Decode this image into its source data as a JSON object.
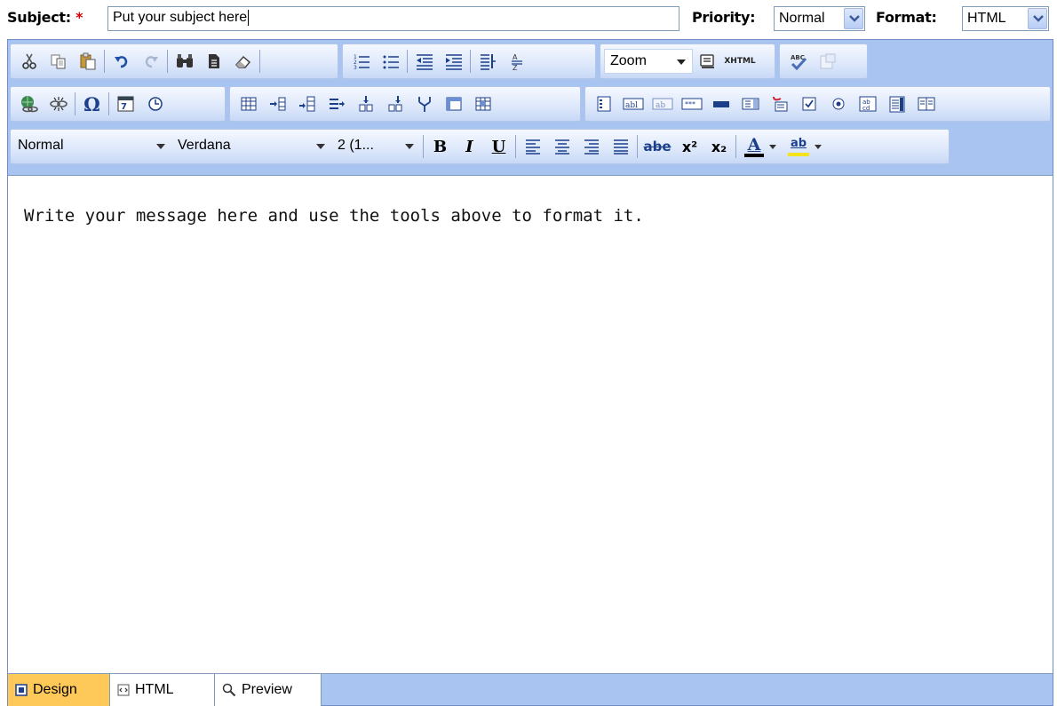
{
  "form": {
    "subject_label": "Subject:",
    "required_mark": "*",
    "subject_value": "Put your subject here",
    "priority_label": "Priority:",
    "priority_value": "Normal",
    "format_label": "Format:",
    "format_value": "HTML"
  },
  "toolbar": {
    "zoom_label": "Zoom",
    "xhtml_label": "XHTML",
    "paragraph_style": "Normal",
    "font_name": "Verdana",
    "font_size": "2 (1...",
    "bold": "B",
    "italic": "I",
    "underline": "U",
    "strike": "abe",
    "superscript": "x²",
    "subscript": "x₂",
    "font_color": "A",
    "highlight": "ab"
  },
  "editor": {
    "body_text": "Write your message here and use the tools above to format it."
  },
  "tabs": [
    {
      "label": "Design"
    },
    {
      "label": "HTML"
    },
    {
      "label": "Preview"
    }
  ],
  "colors": {
    "toolbar_bg": "#a9c4f0",
    "active_tab": "#ffc95a",
    "required": "#d00000"
  }
}
